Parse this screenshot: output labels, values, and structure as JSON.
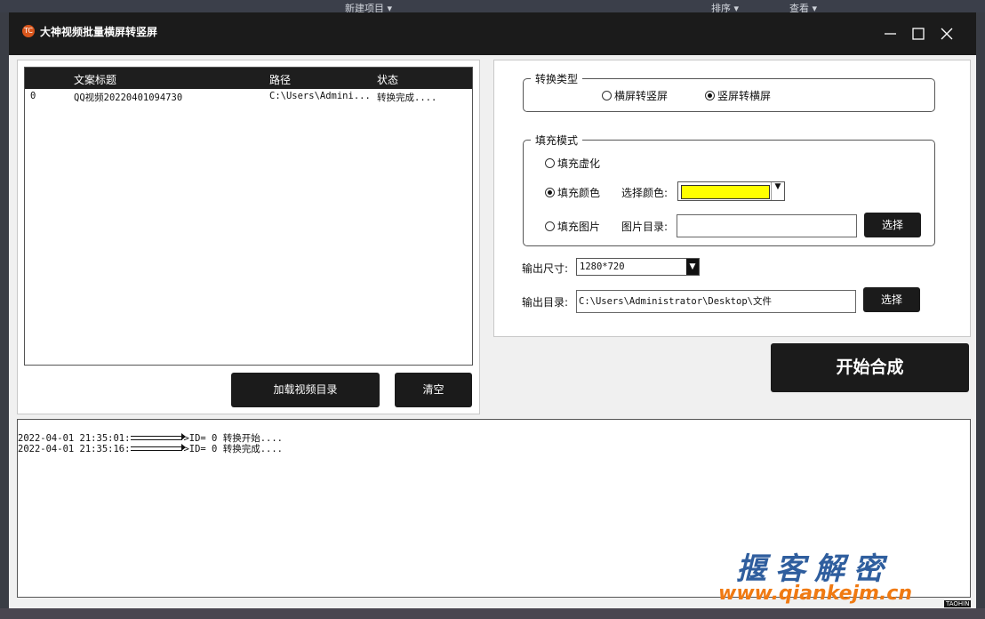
{
  "window": {
    "title": "大神视频批量横屏转竖屏"
  },
  "file_table": {
    "columns": [
      "",
      "文案标题",
      "路径",
      "状态"
    ],
    "rows": [
      {
        "index": "0",
        "title": "QQ视频20220401094730",
        "path": "C:\\Users\\Admini...",
        "status": "转换完成...."
      }
    ]
  },
  "buttons": {
    "load": "加载视频目录",
    "clear": "清空",
    "select_image": "选择",
    "select_output": "选择",
    "start": "开始合成"
  },
  "conversion_type": {
    "legend": "转换类型",
    "options": [
      "横屏转竖屏",
      "竖屏转横屏"
    ],
    "selected": "竖屏转横屏"
  },
  "fill_mode": {
    "legend": "填充模式",
    "blur": "填充虚化",
    "color": "填充颜色",
    "image": "填充图片",
    "selected": "填充颜色",
    "color_label": "选择颜色:",
    "color_value": "#ffff00",
    "image_label": "图片目录:",
    "image_value": ""
  },
  "output": {
    "size_label": "输出尺寸:",
    "size_value": "1280*720",
    "dir_label": "输出目录:",
    "dir_value": "C:\\Users\\Administrator\\Desktop\\文件"
  },
  "log": [
    {
      "time": "2022-04-01 21:35:01:",
      "msg": "ID= 0 转换开始...."
    },
    {
      "time": "2022-04-01 21:35:16:",
      "msg": "ID= 0 转换完成...."
    }
  ],
  "watermark": {
    "line1": "揠客解密",
    "line2": "www.qiankejm.cn",
    "tag": "TAOHIN"
  }
}
